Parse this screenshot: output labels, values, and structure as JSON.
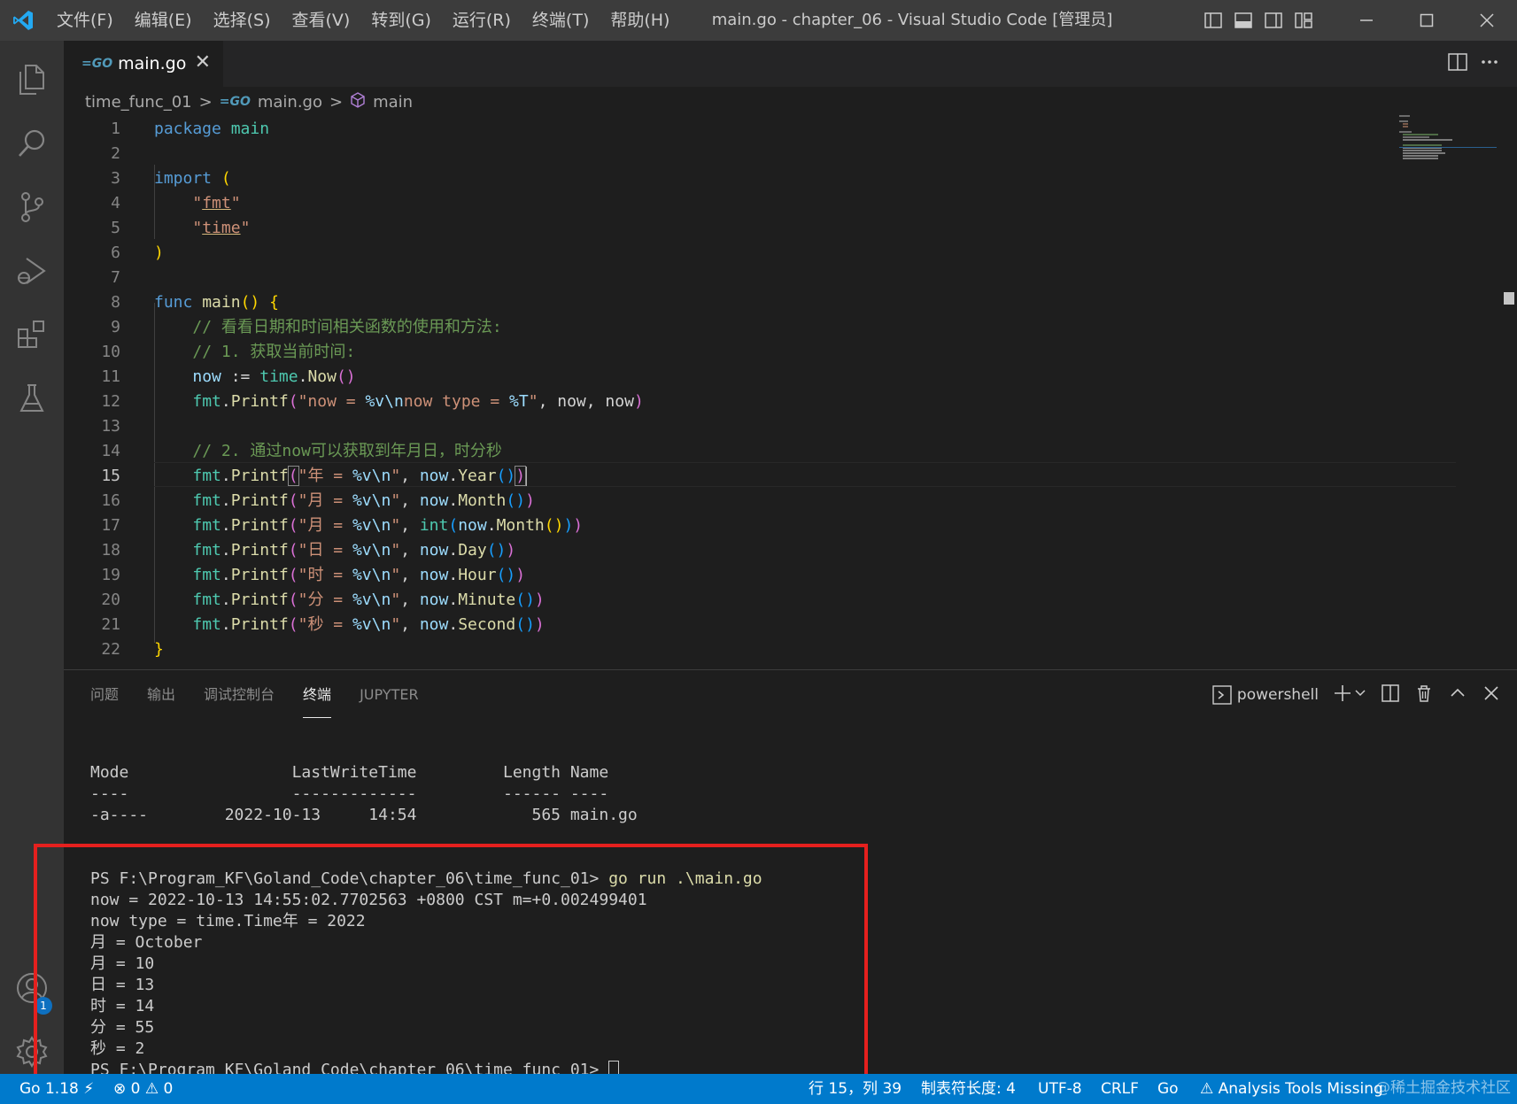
{
  "titlebar": {
    "menu": [
      "文件(F)",
      "编辑(E)",
      "选择(S)",
      "查看(V)",
      "转到(G)",
      "运行(R)",
      "终端(T)",
      "帮助(H)"
    ],
    "window_title": "main.go - chapter_06 - Visual Studio Code [管理员]"
  },
  "activitybar": {
    "accounts_badge": "1"
  },
  "tab": {
    "label": "main.go",
    "close": "✕"
  },
  "breadcrumb": {
    "folder": "time_func_01",
    "file": "main.go",
    "symbol": "main",
    "separator": ">"
  },
  "editor": {
    "line_numbers": [
      "1",
      "2",
      "3",
      "4",
      "5",
      "6",
      "7",
      "8",
      "9",
      "10",
      "11",
      "12",
      "13",
      "14",
      "15",
      "16",
      "17",
      "18",
      "19",
      "20",
      "21",
      "22"
    ],
    "active_line": "15",
    "l1": {
      "kw": "package",
      "name": "main"
    },
    "l3": {
      "kw": "import",
      "paren": "("
    },
    "l4": {
      "q1": "\"",
      "pkg": "fmt",
      "q2": "\""
    },
    "l5": {
      "q1": "\"",
      "pkg": "time",
      "q2": "\""
    },
    "l6": {
      "paren": ")"
    },
    "l8": {
      "kw": "func",
      "name": "main",
      "parens": "()",
      "brace": "{"
    },
    "l9": {
      "comment": "// 看看日期和时间相关函数的使用和方法:"
    },
    "l10": {
      "comment": "// 1. 获取当前时间:"
    },
    "l11": {
      "var": "now",
      "op": " := ",
      "pkg": "time",
      "dot": ".",
      "fn": "Now",
      "call": "()"
    },
    "l12": {
      "pkg": "fmt",
      "dot": ".",
      "fn": "Printf",
      "open": "(",
      "s1": "\"now = ",
      "f1": "%v\\n",
      "s2": "now type = ",
      "f2": "%T",
      "s3": "\"",
      "rest": ", now, now",
      "close": ")"
    },
    "l14": {
      "comment": "// 2. 通过now可以获取到年月日，时分秒"
    },
    "calls": [
      {
        "label": "年",
        "method": "Year",
        "wrap": ""
      },
      {
        "label": "月",
        "method": "Month",
        "wrap": ""
      },
      {
        "label": "月",
        "method": "Month",
        "wrap": "int"
      },
      {
        "label": "日",
        "method": "Day",
        "wrap": ""
      },
      {
        "label": "时",
        "method": "Hour",
        "wrap": ""
      },
      {
        "label": "分",
        "method": "Minute",
        "wrap": ""
      },
      {
        "label": "秒",
        "method": "Second",
        "wrap": ""
      }
    ],
    "call_parts": {
      "pkg": "fmt",
      "dot": ".",
      "fn": "Printf",
      "open": "(",
      "q": "\"",
      "eq": " = ",
      "fmt": "%v\\n",
      "sep": ", ",
      "recv": "now",
      "int": "int"
    },
    "l22": {
      "brace": "}"
    }
  },
  "panel": {
    "tabs": [
      "问题",
      "输出",
      "调试控制台",
      "终端",
      "JUPYTER"
    ],
    "active_tab": "终端",
    "shell": "powershell"
  },
  "terminal": {
    "lines": [
      "Mode                 LastWriteTime         Length Name",
      "----                 -------------         ------ ----",
      "-a----        2022-10-13     14:54            565 main.go",
      "",
      "",
      "now = 2022-10-13 14:55:02.7702563 +0800 CST m=+0.002499401",
      "now type = time.Time年 = 2022",
      "月 = October",
      "月 = 10",
      "日 = 13",
      "时 = 14",
      "分 = 55",
      "秒 = 2"
    ],
    "prompt": "PS F:\\Program_KF\\Goland_Code\\chapter_06\\time_func_01> ",
    "command": "go run .\\main.go"
  },
  "statusbar": {
    "go_version": "Go 1.18",
    "errors": "0",
    "warnings": "0",
    "position": "行 15，列 39",
    "tab_size": "制表符长度: 4",
    "encoding": "UTF-8",
    "eol": "CRLF",
    "language": "Go",
    "analysis": "Analysis Tools Missing"
  },
  "watermark": "@稀土掘金技术社区",
  "colors": {
    "accent": "#007acc",
    "highlight_box": "#e5201e",
    "titlebar": "#3c3c3c",
    "activitybar": "#333333",
    "editor_bg": "#1e1e1e"
  }
}
